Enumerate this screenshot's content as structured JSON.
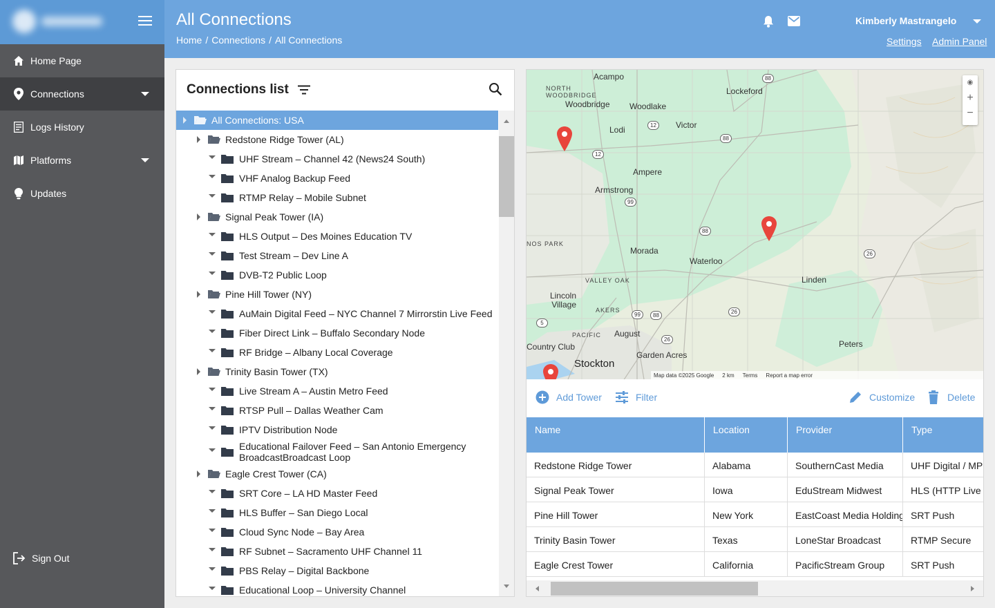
{
  "sidebar": {
    "items": [
      {
        "label": "Home Page",
        "icon": "home-icon"
      },
      {
        "label": "Connections",
        "icon": "location-pin-icon"
      },
      {
        "label": "Logs History",
        "icon": "document-icon"
      },
      {
        "label": "Platforms",
        "icon": "map-icon"
      },
      {
        "label": "Updates",
        "icon": "lightbulb-icon"
      }
    ],
    "signout_label": "Sign Out"
  },
  "header": {
    "title": "All Connections",
    "breadcrumb": [
      "Home",
      "/",
      "Connections",
      "/",
      "All Connections"
    ],
    "user_name": "Kimberly Mastrangelo",
    "settings_label": "Settings",
    "admin_label": "Admin Panel"
  },
  "list": {
    "title": "Connections list",
    "tree": [
      {
        "label": "All Connections: USA",
        "level": 0
      },
      {
        "label": "Redstone Ridge Tower (AL)",
        "level": 1
      },
      {
        "label": "UHF Stream – Channel 42 (News24 South)",
        "level": 2
      },
      {
        "label": "VHF Analog Backup Feed",
        "level": 2
      },
      {
        "label": "RTMP Relay – Mobile Subnet",
        "level": 2
      },
      {
        "label": "Signal Peak Tower (IA)",
        "level": 1
      },
      {
        "label": "HLS Output – Des Moines Education TV",
        "level": 2
      },
      {
        "label": "Test Stream – Dev Line A",
        "level": 2
      },
      {
        "label": "DVB-T2 Public Loop",
        "level": 2
      },
      {
        "label": "Pine Hill Tower (NY)",
        "level": 1
      },
      {
        "label": "AuMain Digital Feed – NYC Channel 7 Mirrorstin Live Feed",
        "level": 2
      },
      {
        "label": "Fiber Direct Link – Buffalo Secondary Node",
        "level": 2
      },
      {
        "label": "RF Bridge – Albany Local Coverage",
        "level": 2
      },
      {
        "label": "Trinity Basin Tower (TX)",
        "level": 1
      },
      {
        "label": "Live Stream A – Austin Metro Feed",
        "level": 2
      },
      {
        "label": "RTSP Pull – Dallas Weather Cam",
        "level": 2
      },
      {
        "label": "IPTV Distribution Node",
        "level": 2
      },
      {
        "label": "Educational Failover Feed – San Antonio Emergency BroadcastBroadcast Loop",
        "level": 2
      },
      {
        "label": "Eagle Crest Tower (CA)",
        "level": 1
      },
      {
        "label": "SRT Core – LA HD Master Feed",
        "level": 2
      },
      {
        "label": "HLS Buffer – San Diego Local",
        "level": 2
      },
      {
        "label": "Cloud Sync Node – Bay Area",
        "level": 2
      },
      {
        "label": "RF Subnet – Sacramento UHF Channel 11",
        "level": 2
      },
      {
        "label": "PBS Relay – Digital Backbone",
        "level": 2
      },
      {
        "label": "Educational Loop – University Channel",
        "level": 2
      }
    ]
  },
  "map": {
    "places": [
      "Acampo",
      "NORTH WOODBRIDGE",
      "Woodbridge",
      "Lockeford",
      "Woodlake",
      "Victor",
      "Lodi",
      "Ampere",
      "Armstrong",
      "NOS PARK",
      "Morada",
      "Waterloo",
      "VALLEY OAK",
      "Linden",
      "Lincoln Village",
      "AKERS",
      "PACIFIC",
      "August",
      "Country Club",
      "Garden Acres",
      "Peters",
      "Stockton"
    ],
    "routes": [
      "88",
      "12",
      "12",
      "88",
      "99",
      "88",
      "26",
      "99",
      "88",
      "26",
      "5",
      "26"
    ],
    "footer": [
      "Map data ©2025 Google",
      "2 km",
      "Terms",
      "Report a map error"
    ],
    "zoom_in": "+",
    "zoom_out": "−",
    "pin_color": "#e8453c"
  },
  "toolbar": {
    "add": "Add Tower",
    "filter": "Filter",
    "customize": "Customize",
    "delete": "Delete"
  },
  "grid": {
    "columns": [
      "Name",
      "Location",
      "Provider",
      "Type"
    ],
    "rows": [
      [
        "Redstone Ridge Tower",
        "Alabama",
        "SouthernCast Media",
        "UHF Digital / MP"
      ],
      [
        "Signal Peak Tower",
        "Iowa",
        "EduStream Midwest",
        "HLS (HTTP Live S"
      ],
      [
        "Pine Hill Tower",
        "New York",
        "EastCoast Media Holding",
        "SRT Push"
      ],
      [
        "Trinity Basin Tower",
        "Texas",
        "LoneStar Broadcast",
        "RTMP Secure"
      ],
      [
        "Eagle Crest Tower",
        "California",
        "PacificStream Group",
        "SRT Push"
      ]
    ]
  },
  "colors": {
    "accent": "#6da5de",
    "sidebar": "#57585b",
    "sidebar_active": "#3f4043",
    "link": "#5e9ad8"
  }
}
